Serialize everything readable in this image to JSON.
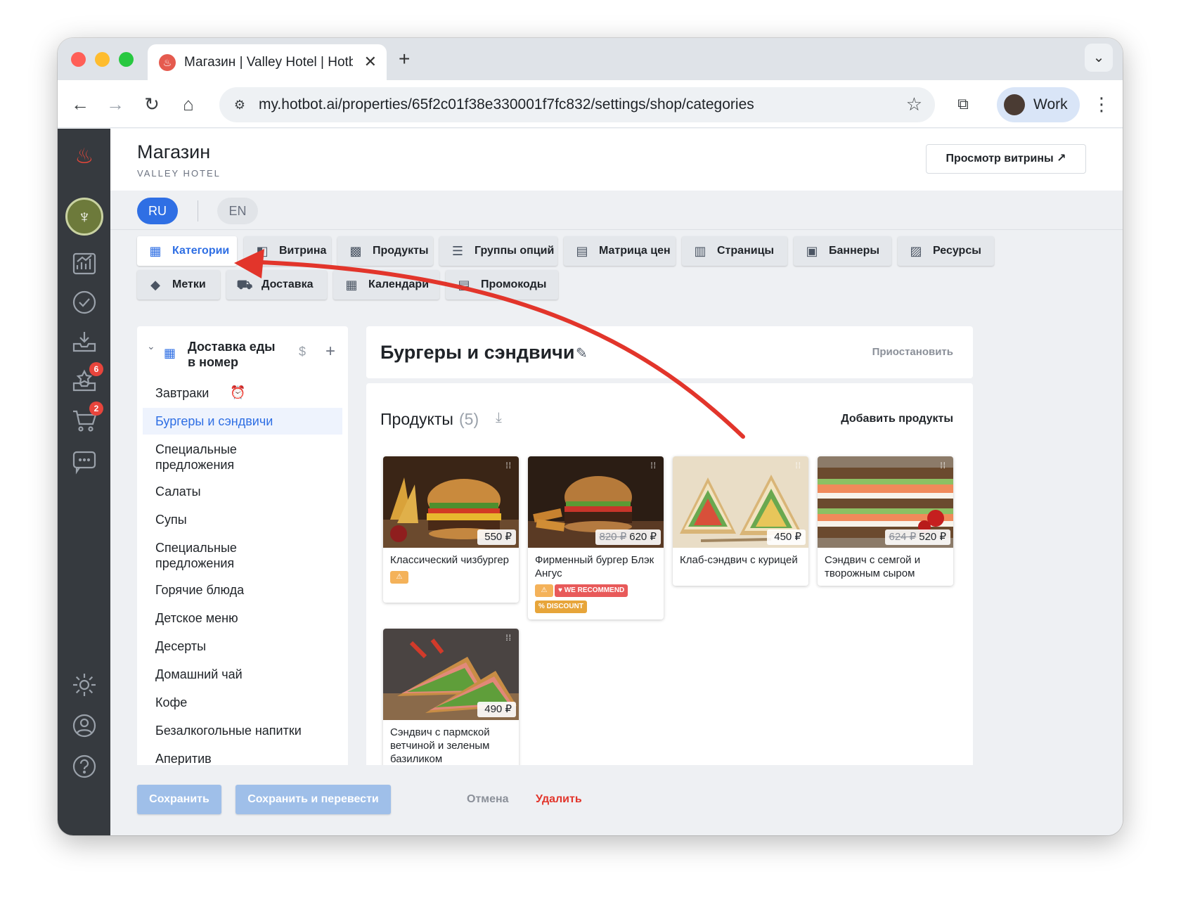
{
  "browser": {
    "tab_title": "Магазин | Valley Hotel | Hotbot",
    "tab_close": "✕",
    "new_tab": "+",
    "url": "my.hotbot.ai/properties/65f2c01f38e330001f7fc832/settings/shop/categories",
    "profile_label": "Work"
  },
  "header": {
    "title": "Магазин",
    "subtitle": "VALLEY HOTEL",
    "preview_button": "Просмотр витрины ↗"
  },
  "languages": {
    "active": "RU",
    "other": "EN"
  },
  "nav_badges": {
    "reviews": "6",
    "orders": "2"
  },
  "settings_tabs": [
    {
      "label": "Категории",
      "icon": "store-icon"
    },
    {
      "label": "Витрина",
      "icon": "showcase-icon"
    },
    {
      "label": "Продукты",
      "icon": "products-icon"
    },
    {
      "label": "Группы опций",
      "icon": "options-icon"
    },
    {
      "label": "Матрица цен",
      "icon": "price-matrix-icon"
    },
    {
      "label": "Страницы",
      "icon": "pages-icon"
    },
    {
      "label": "Баннеры",
      "icon": "banners-icon"
    },
    {
      "label": "Ресурсы",
      "icon": "resources-icon"
    },
    {
      "label": "Метки",
      "icon": "tag-icon"
    },
    {
      "label": "Доставка",
      "icon": "truck-icon"
    },
    {
      "label": "Календари",
      "icon": "calendar-icon"
    },
    {
      "label": "Промокоды",
      "icon": "promo-icon"
    }
  ],
  "categories": {
    "group_title": "Доставка еды в номер",
    "group_dollar": "$",
    "group_add": "+",
    "items": [
      "Завтраки",
      "Бургеры и сэндвичи",
      "Специальные предложения",
      "Салаты",
      "Супы",
      "Специальные предложения",
      "Горячие блюда",
      "Детское меню",
      "Десерты",
      "Домашний чай",
      "Кофе",
      "Безалкогольные напитки",
      "Аперитив"
    ],
    "active_index": 1
  },
  "category": {
    "title": "Бургеры и сэндвичи",
    "pause": "Приостановить"
  },
  "products": {
    "title": "Продукты",
    "count": "(5)",
    "add": "Добавить продукты",
    "items": [
      {
        "name": "Классический чизбургер",
        "price": "550 ₽",
        "old_price": "",
        "tags": [
          "⚠"
        ]
      },
      {
        "name": "Фирменный бургер Блэк Ангус",
        "price": "620 ₽",
        "old_price": "820 ₽",
        "tags": [
          "⚠",
          "♥ WE RECOMMEND",
          "% DISCOUNT"
        ]
      },
      {
        "name": "Клаб-сэндвич с курицей",
        "price": "450 ₽",
        "old_price": "",
        "tags": []
      },
      {
        "name": "Сэндвич с семгой и творожным сыром",
        "price": "520 ₽",
        "old_price": "624 ₽",
        "tags": []
      },
      {
        "name": "Сэндвич с пармской ветчиной и зеленым базиликом",
        "price": "490 ₽",
        "old_price": "",
        "tags": []
      }
    ]
  },
  "footer": {
    "save": "Сохранить",
    "save_translate": "Сохранить и перевести",
    "cancel": "Отмена",
    "delete": "Удалить"
  },
  "colors": {
    "accent": "#2f6fe4",
    "annotation_arrow": "#e2352b",
    "sidebar": "#363a3f",
    "danger": "#e2352b"
  }
}
